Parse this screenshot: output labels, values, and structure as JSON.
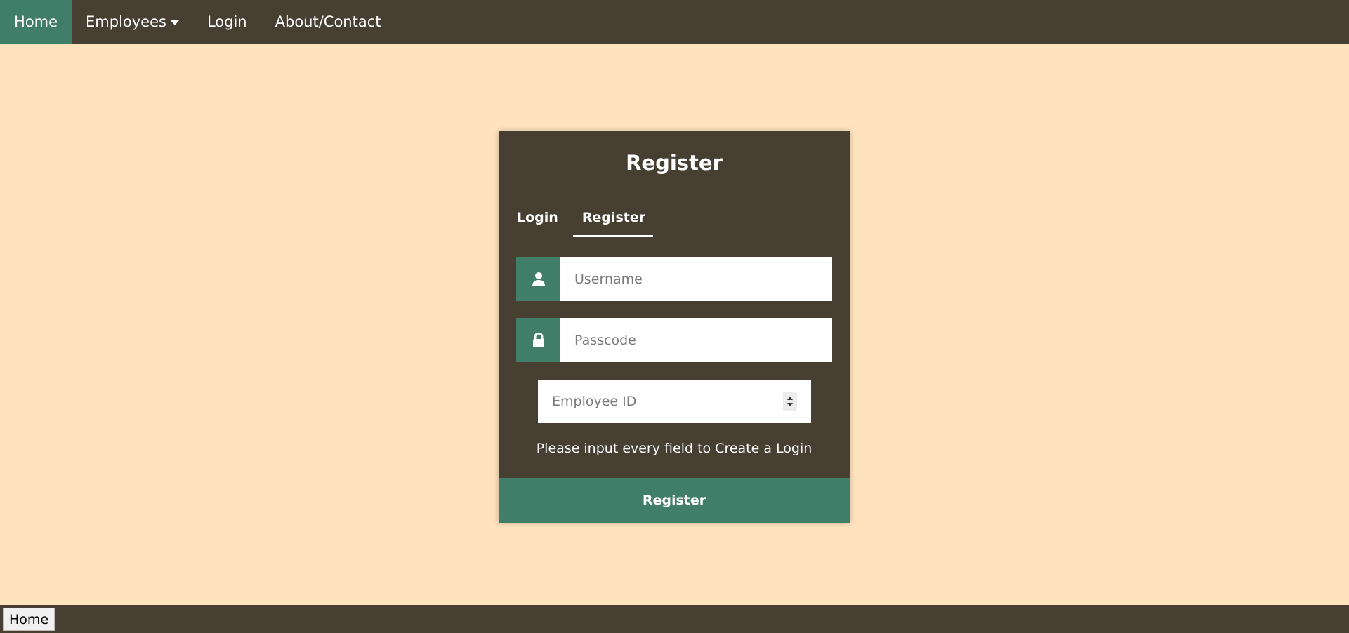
{
  "nav": {
    "items": [
      {
        "label": "Home",
        "active": true
      },
      {
        "label": "Employees",
        "dropdown": true
      },
      {
        "label": "Login"
      },
      {
        "label": "About/Contact"
      }
    ]
  },
  "card": {
    "title": "Register",
    "tabs": [
      {
        "label": "Login",
        "active": false
      },
      {
        "label": "Register",
        "active": true
      }
    ],
    "fields": {
      "username_placeholder": "Username",
      "username_icon": "user-icon",
      "passcode_placeholder": "Passcode",
      "passcode_icon": "lock-icon",
      "employee_id_placeholder": "Employee ID"
    },
    "hint": "Please input every field to Create a Login",
    "submit_label": "Register"
  },
  "footer": {
    "button_label": "Home"
  },
  "colors": {
    "background": "#ffe3bf",
    "dark": "#483f33",
    "accent": "#407e69"
  }
}
